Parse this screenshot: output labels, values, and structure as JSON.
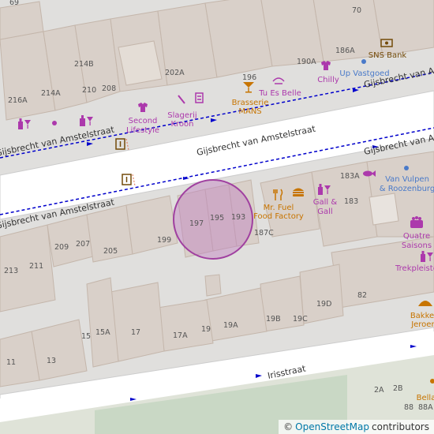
{
  "map": {
    "streets": {
      "gijsbrecht_main": "Gijsbrecht van Amstelstraat",
      "gijsbrecht_left_upper": "Gijsbrecht van Amstelstraat",
      "gijsbrecht_left_lower": "Gijsbrecht van Amstelstraat",
      "gijsbrecht_right_upper": "Gijsbrecht van Ams",
      "gijsbrecht_right_lower": "Gijsbrecht van Amstelstraat",
      "irisstraat": "Irisstraat"
    },
    "house_numbers": {
      "n69": "69",
      "n70": "70",
      "n214b": "214B",
      "n202a": "202A",
      "n196": "196",
      "n190a": "190A",
      "n186a": "186A",
      "n216a": "216A",
      "n214a": "214A",
      "n210": "210",
      "n208": "208",
      "n183a": "183A",
      "n183": "183",
      "n197": "197",
      "n195": "195",
      "n193": "193",
      "n187c": "187C",
      "n199": "199",
      "n209": "209",
      "n207": "207",
      "n205": "205",
      "n213": "213",
      "n211": "211",
      "n82": "82",
      "n19d": "19D",
      "n19b": "19B",
      "n19c": "19C",
      "n15a": "15A",
      "n17": "17",
      "n17a": "17A",
      "n19": "19",
      "n19a": "19A",
      "n15": "15",
      "n13": "13",
      "n11": "11",
      "n2a": "2A",
      "n2b": "2B",
      "n88": "88",
      "n88a": "88A"
    },
    "pois": {
      "sns_bank": "SNS Bank",
      "up_vastgoed": "Up Vastgoed",
      "chilly": "Chilly",
      "tu_es_belle": "Tu Es Belle",
      "brasserie_line1": "Brasserie",
      "brasserie_line2": "MANS",
      "slagerij_line1": "Slagerij",
      "slagerij_line2": "Kroon",
      "second_line1": "Second",
      "second_line2": "Lifestyle",
      "van_vulpen_line1": "Van Vulpen",
      "van_vulpen_line2": "& Roozenburg",
      "gall_line1": "Gall &",
      "gall_line2": "Gall",
      "mr_fuel_line1": "Mr. Fuel",
      "mr_fuel_line2": "Food Factory",
      "quatre_line1": "Quatre",
      "quatre_line2": "Saisons",
      "trekpleister": "Trekpleister",
      "bakker_line1": "Bakke",
      "bakker_line2": "Jeroen",
      "bella": "Bella"
    },
    "colors": {
      "background": "#e0dfdd",
      "building": "#d9d0c9",
      "building_stroke": "#c4b6ab",
      "road": "#ffffff",
      "shop_poi": "#ac39ac",
      "food_poi": "#c77400",
      "civic_poi": "#734a08",
      "bank_poi": "#734a08",
      "route_line": "#0000cc",
      "marker_fill": "#c080c0",
      "marker_stroke": "#a040a0",
      "label": "#555555"
    },
    "icons": {
      "bank": "bank-icon",
      "shop_dot": "shop-dot-icon",
      "clothes": "clothes-icon",
      "beauty": "beauty-icon",
      "bar": "cocktail-icon",
      "butcher": "butcher-icon",
      "knife": "knife-icon",
      "wine": "wine-icon",
      "fish": "fish-icon",
      "restaurant": "restaurant-icon",
      "fastfood": "burger-icon",
      "bakery": "bakery-icon",
      "cake": "cake-icon",
      "atm": "info-board-icon"
    }
  },
  "attribution": {
    "copyright_symbol": "©",
    "link_text": "OpenStreetMap",
    "suffix": "contributors"
  }
}
